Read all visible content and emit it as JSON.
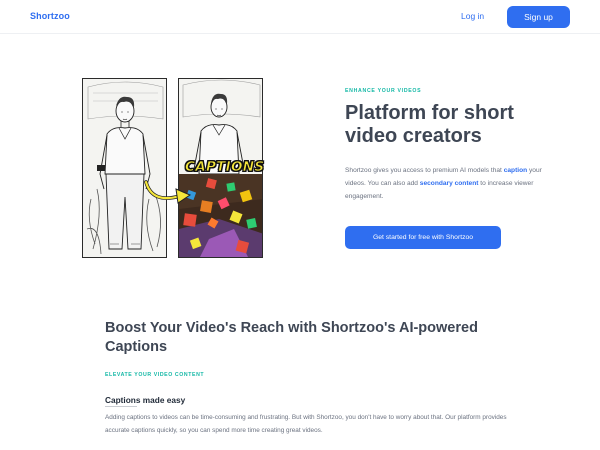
{
  "header": {
    "logo": "Shortzoo",
    "login_label": "Log in",
    "signup_label": "Sign up"
  },
  "hero": {
    "eyebrow": "ENHANCE YOUR VIDEOS",
    "title": "Platform for short video creators",
    "desc_part1": "Shortzoo gives you access to premium AI models that ",
    "desc_hl1": "caption",
    "desc_part2": " your videos. You can also add ",
    "desc_hl2": "secondary content",
    "desc_part3": " to increase viewer engagement.",
    "cta_label": "Get started for free with Shortzoo",
    "illustration_caption": "CAPTIONS"
  },
  "section": {
    "title": "Boost Your Video's Reach with Shortzoo's AI-powered Captions",
    "eyebrow": "ELEVATE YOUR VIDEO CONTENT",
    "feature_title": "Captions made easy",
    "feature_desc": "Adding captions to videos can be time-consuming and frustrating. But with Shortzoo, you don't have to worry about that. Our platform provides accurate captions quickly, so you can spend more time creating great videos."
  },
  "colors": {
    "brand_blue": "#2f6ef0",
    "accent_teal": "#14b8a6",
    "heading": "#3e4654",
    "caption_yellow": "#f5e63a"
  }
}
